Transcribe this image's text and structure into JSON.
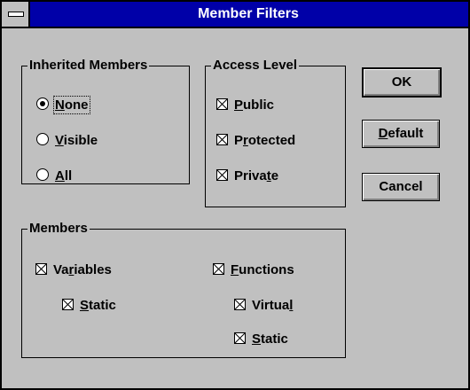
{
  "window": {
    "title": "Member Filters"
  },
  "inherited": {
    "label": "Inherited Members",
    "options": [
      {
        "pre": "",
        "key": "N",
        "post": "one",
        "selected": true
      },
      {
        "pre": "",
        "key": "V",
        "post": "isible",
        "selected": false
      },
      {
        "pre": "",
        "key": "A",
        "post": "ll",
        "selected": false
      }
    ]
  },
  "access": {
    "label": "Access Level",
    "options": [
      {
        "pre": "",
        "key": "P",
        "post": "ublic",
        "checked": true
      },
      {
        "pre": "P",
        "key": "r",
        "post": "otected",
        "checked": true
      },
      {
        "pre": "Priva",
        "key": "t",
        "post": "e",
        "checked": true
      }
    ]
  },
  "members": {
    "label": "Members",
    "variables": {
      "pre": "Va",
      "key": "r",
      "post": "iables",
      "checked": true
    },
    "variables_static": {
      "pre": "",
      "key": "S",
      "post": "tatic",
      "checked": true
    },
    "functions": {
      "pre": "",
      "key": "F",
      "post": "unctions",
      "checked": true
    },
    "functions_virtual": {
      "pre": "Virtua",
      "key": "l",
      "post": "",
      "checked": true
    },
    "functions_static": {
      "pre": "",
      "key": "S",
      "post": "tatic",
      "checked": true
    }
  },
  "buttons": {
    "ok": {
      "pre": "OK",
      "key": "",
      "post": ""
    },
    "default": {
      "pre": "",
      "key": "D",
      "post": "efault"
    },
    "cancel": {
      "pre": "Cancel",
      "key": "",
      "post": ""
    }
  }
}
